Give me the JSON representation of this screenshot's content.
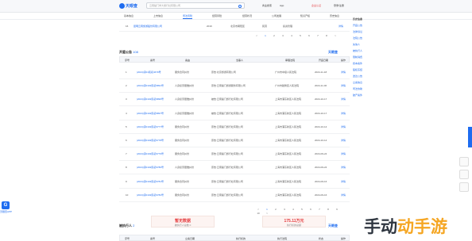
{
  "header": {
    "logo_text": "天眼查",
    "search_placeholder": "云南楚门学大旅行社有限公司",
    "links": [
      "商业搜索",
      "App",
      "企业认证",
      "登录/注册"
    ]
  },
  "nav": {
    "tabs": [
      "基本信息",
      "上市信息",
      "司法风险",
      "经营风险",
      "经营状况",
      "公司发展",
      "知识产权",
      "历史信息"
    ],
    "active_index": 2
  },
  "top_table": {
    "rows": [
      {
        "no": "16",
        "name": "昆明云南旅游股份有限公司",
        "a": "2019",
        "b": "北京市朝阳区",
        "c": "民营",
        "d": "投资管理",
        "e": "详情"
      }
    ],
    "pager": [
      "<",
      "1",
      "2",
      "3",
      "4",
      "5",
      "6",
      "7",
      "8",
      ">"
    ]
  },
  "legal_section": {
    "title": "开庭公告",
    "count": "108",
    "brand": "天眼查",
    "columns": [
      "序号",
      "案号",
      "案由",
      "当事人",
      "审理法院",
      "开庭日期",
      "操作"
    ],
    "rows": [
      {
        "no": "1",
        "case": "(2024)滇01民初4679号",
        "cause": "服务合同纠纷",
        "party": "原告:北京旅游有限公司",
        "court": "广州市中级人民法院",
        "date": "2024-11-18",
        "op": "详情"
      },
      {
        "no": "2",
        "case": "(2024)滇0102民初3891号",
        "cause": "人身损害赔偿纠纷",
        "party": "原告:云南楚门旅游服务有限公司",
        "court": "广州市越秀区人民法院",
        "date": "2024-11-06",
        "op": "详情"
      },
      {
        "no": "3",
        "case": "(2024)滇0102民初3896号",
        "cause": "人身损害赔偿纠纷",
        "party": "被告:云南楚门旅行社有限公司",
        "court": "上海市浦东新区人民法院",
        "date": "2024-10-17",
        "op": "详情"
      },
      {
        "no": "4",
        "case": "(2024)滇0102民初3897号",
        "cause": "人身损害赔偿纠纷",
        "party": "被告:云南楚门旅行社有限公司",
        "court": "上海市浦东新区人民法院",
        "date": "2024-10-17",
        "op": "详情"
      },
      {
        "no": "5",
        "case": "(2024)滇0102民初3777号",
        "cause": "服务合同纠纷",
        "party": "原告:云南楚门旅行社有限公司",
        "court": "上海市浦东新区人民法院",
        "date": "2024-10-14",
        "op": "详情"
      },
      {
        "no": "6",
        "case": "(2024)滇0102民初3778号",
        "cause": "服务合同纠纷",
        "party": "原告:云南楚门旅行社有限公司",
        "court": "上海市浦东新区人民法院",
        "date": "2024-10-14",
        "op": "详情"
      },
      {
        "no": "7",
        "case": "(2024)滇0102民初3779号",
        "cause": "服务合同纠纷",
        "party": "原告:云南楚门旅行社有限公司",
        "court": "上海市浦东新区人民法院",
        "date": "2024-09-24",
        "op": "详情"
      },
      {
        "no": "8",
        "case": "(2024)滇0102民初3780号",
        "cause": "人身损害赔偿纠纷",
        "party": "原告:云南楚门旅行社有限公司",
        "court": "上海市浦东新区人民法院",
        "date": "2024-09-24",
        "op": "详情"
      },
      {
        "no": "9",
        "case": "(2024)滇0102民初3781号",
        "cause": "服务合同纠纷",
        "party": "原告:云南楚门旅行社有限公司",
        "court": "上海市浦东新区人民法院",
        "date": "2024-09-16",
        "op": "详情"
      },
      {
        "no": "10",
        "case": "(2024)滇0102民初3782号",
        "cause": "服务合同纠纷",
        "party": "原告:云南楚门旅行社有限公司",
        "court": "上海市浦东新区人民法院",
        "date": "2024-09-16",
        "op": "详情"
      }
    ],
    "pager": [
      "<",
      "1",
      "2",
      "3",
      "4",
      "5",
      "6",
      "7",
      "8",
      "9",
      "10",
      ">"
    ]
  },
  "exec_section": {
    "title": "被执行人",
    "count": "2",
    "brand": "天眼查",
    "highlights": [
      {
        "big": "暂无数据",
        "small": "被执行人总数 0"
      },
      {
        "big": "175.11万元",
        "small": "执行标的总额"
      }
    ],
    "columns": [
      "序号",
      "案号",
      "立案日期",
      "执行标的",
      "执行法院",
      "状态",
      "操作"
    ]
  },
  "sidebar": {
    "items": [
      "历史信息",
      "开庭公告",
      "法律诉讼",
      "法院公告",
      "失信人",
      "被执行人",
      "限制消费",
      "终本案件",
      "股权冻结",
      "送达公告",
      "立案信息",
      "司法协助",
      "破产案件"
    ]
  },
  "app_badge": {
    "icon_text": "G",
    "label": "天眼查APP"
  },
  "watermark": {
    "text": "手动",
    "sub": "动手游"
  }
}
